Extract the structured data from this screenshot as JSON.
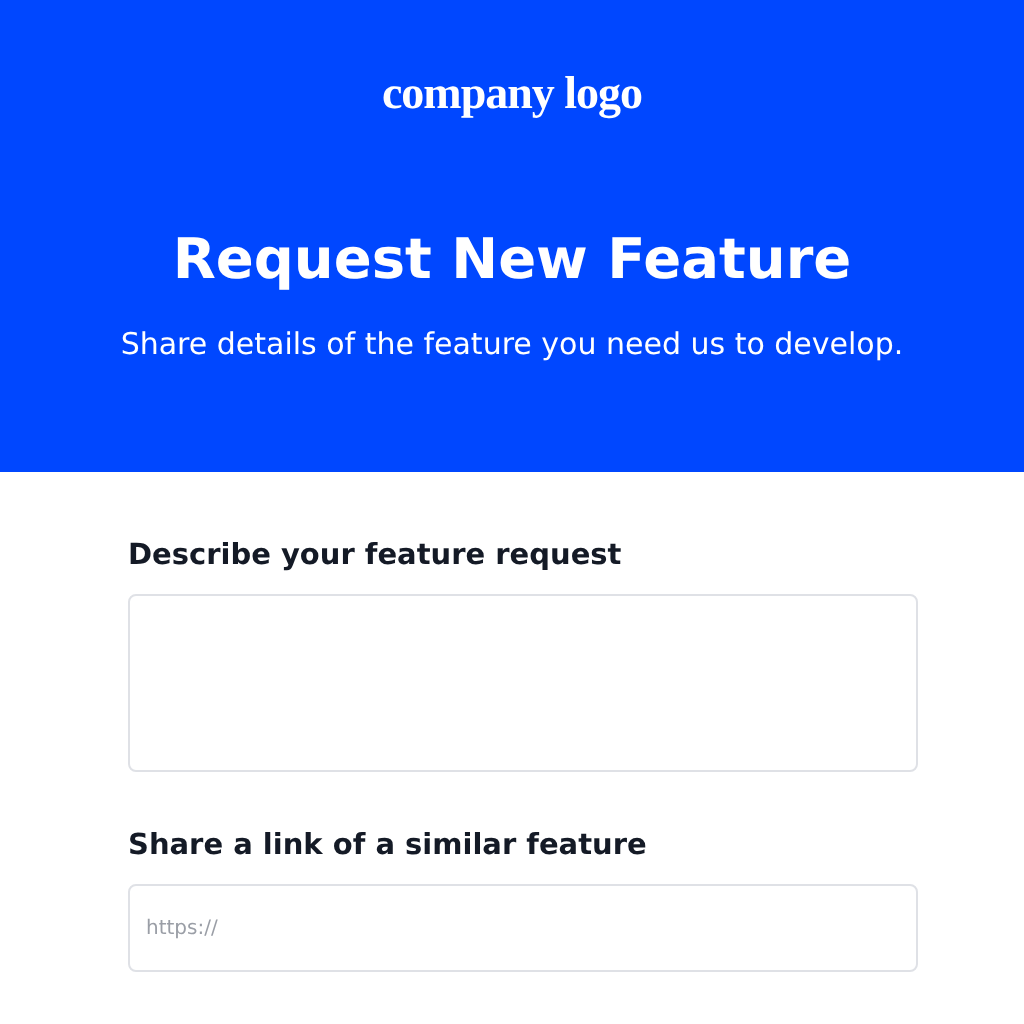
{
  "header": {
    "logo": "company logo",
    "title": "Request New Feature",
    "subtitle": "Share details of the feature you need us to develop."
  },
  "fields": [
    {
      "kind": "textarea",
      "label": "Describe your feature request"
    },
    {
      "kind": "text",
      "label": "Share a link of a similar feature",
      "placeholder": "https://"
    }
  ]
}
